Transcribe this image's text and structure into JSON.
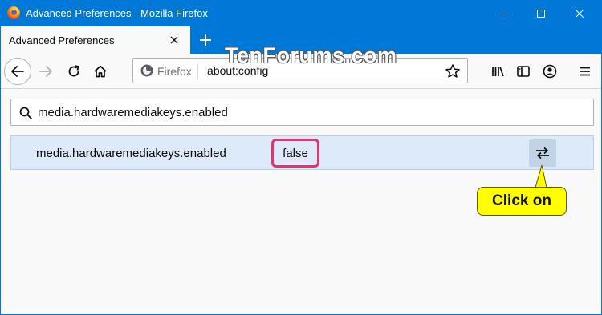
{
  "window": {
    "title": "Advanced Preferences - Mozilla Firefox"
  },
  "tabs": [
    {
      "label": "Advanced Preferences"
    }
  ],
  "urlbar": {
    "identity_label": "Firefox",
    "url": "about:config"
  },
  "watermark": "TenForums.com",
  "search": {
    "value": "media.hardwaremediakeys.enabled"
  },
  "preference": {
    "name": "media.hardwaremediakeys.enabled",
    "value": "false"
  },
  "callout": {
    "text": "Click on"
  },
  "colors": {
    "titlebar": "#0078d7",
    "row_highlight": "#ddeaf9",
    "value_outline": "#e5356a",
    "callout_fill": "#ffff00"
  },
  "icons": [
    "firefox-logo-icon",
    "minimize-icon",
    "maximize-icon",
    "close-icon",
    "tab-close-icon",
    "plus-icon",
    "back-arrow-icon",
    "forward-arrow-icon",
    "reload-icon",
    "home-icon",
    "firefox-identity-icon",
    "star-icon",
    "library-icon",
    "sidebar-icon",
    "account-icon",
    "hamburger-menu-icon",
    "search-icon",
    "toggle-arrows-icon"
  ]
}
